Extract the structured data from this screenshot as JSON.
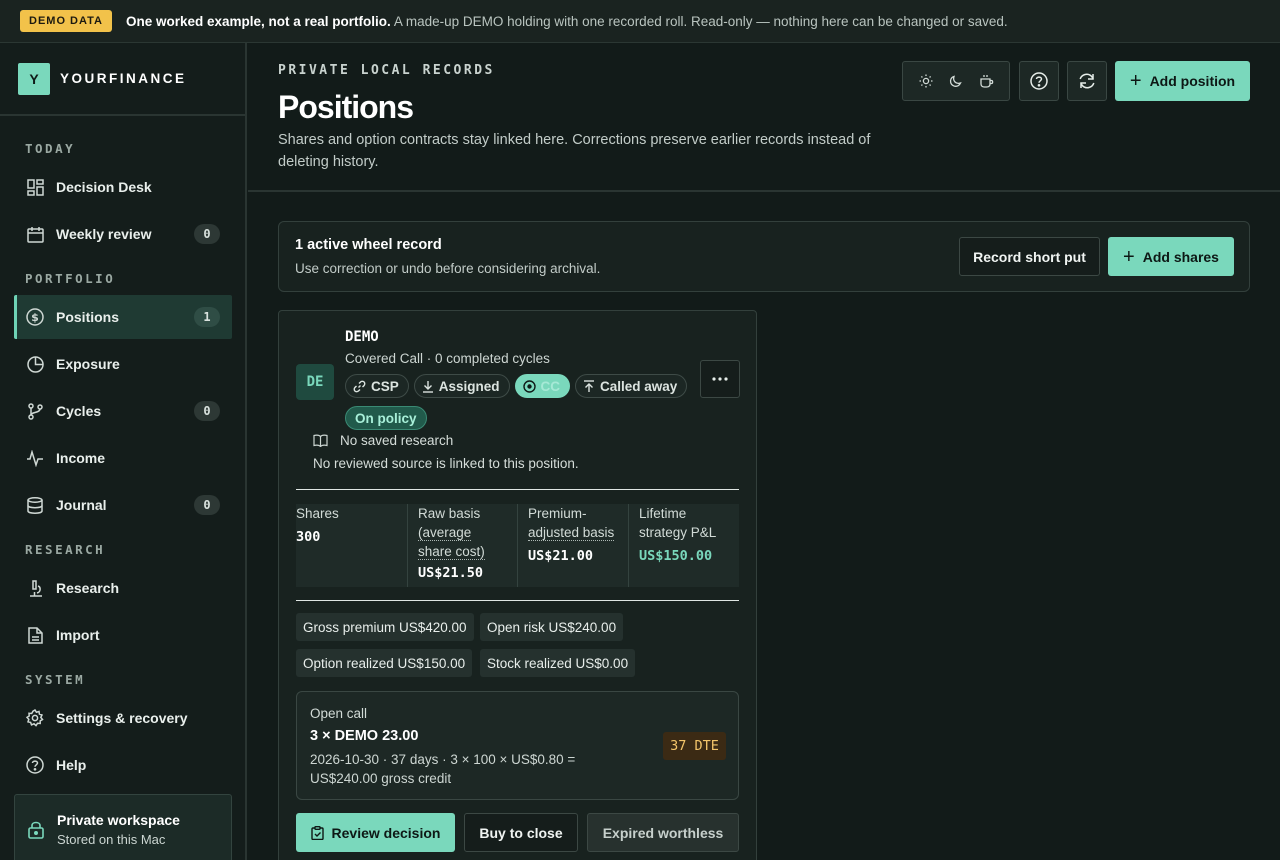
{
  "banner": {
    "badge": "DEMO DATA",
    "headline": "One worked example, not a real portfolio.",
    "text": "A made-up DEMO holding with one recorded roll. Read-only — nothing here can be changed or saved."
  },
  "brand": {
    "logo_letter": "Y",
    "name": "YOURFINANCE"
  },
  "sidebar": {
    "sections": [
      {
        "title": "TODAY",
        "items": [
          {
            "label": "Decision Desk",
            "icon": "grid-icon"
          },
          {
            "label": "Weekly review",
            "icon": "calendar-icon",
            "count": "0"
          }
        ]
      },
      {
        "title": "PORTFOLIO",
        "items": [
          {
            "label": "Positions",
            "icon": "dollar-circle-icon",
            "count": "1",
            "active": true
          },
          {
            "label": "Exposure",
            "icon": "pie-icon"
          },
          {
            "label": "Cycles",
            "icon": "branch-icon",
            "count": "0"
          },
          {
            "label": "Income",
            "icon": "pulse-icon"
          },
          {
            "label": "Journal",
            "icon": "database-icon",
            "count": "0"
          }
        ]
      },
      {
        "title": "RESEARCH",
        "items": [
          {
            "label": "Research",
            "icon": "microscope-icon"
          },
          {
            "label": "Import",
            "icon": "file-icon"
          }
        ]
      },
      {
        "title": "SYSTEM",
        "items": [
          {
            "label": "Settings & recovery",
            "icon": "gear-icon"
          },
          {
            "label": "Help",
            "icon": "help-icon"
          }
        ]
      }
    ],
    "workspace": {
      "title": "Private workspace",
      "subtitle": "Stored on this Mac"
    }
  },
  "header": {
    "eyebrow": "PRIVATE LOCAL RECORDS",
    "title": "Positions",
    "description": "Shares and option contracts stay linked here. Corrections preserve earlier records instead of deleting history.",
    "add_position_label": "Add position"
  },
  "summary": {
    "title": "1 active wheel record",
    "subtitle": "Use correction or undo before considering archival.",
    "record_short_put_label": "Record short put",
    "add_shares_label": "Add shares"
  },
  "position": {
    "avatar": "DE",
    "ticker": "DEMO",
    "strategy": "Covered Call · 0 completed cycles",
    "stages": [
      {
        "label": "CSP",
        "icon": "link-icon"
      },
      {
        "label": "Assigned",
        "icon": "download-icon"
      },
      {
        "label": "CC",
        "icon": "target-icon",
        "current": true
      },
      {
        "label": "Called away",
        "icon": "upload-icon"
      }
    ],
    "policy": "On policy",
    "research_title": "No saved research",
    "research_note": "No reviewed source is linked to this position.",
    "metrics": [
      {
        "label": "Shares",
        "value": "300"
      },
      {
        "label_top": "Raw basis",
        "label_ul": "(average share cost)",
        "value": "US$21.50"
      },
      {
        "label_top": "Premium-",
        "label_ul": "adjusted basis",
        "value": "US$21.00"
      },
      {
        "label": "Lifetime strategy P&L",
        "value": "US$150.00"
      }
    ],
    "pills": {
      "gross_premium": "Gross premium US$420.00",
      "open_risk": "Open risk US$240.00",
      "option_realized": "Option realized US$150.00",
      "stock_realized": "Stock realized US$0.00"
    },
    "open_call": {
      "label": "Open call",
      "title": "3 × DEMO 23.00",
      "detail": "2026-10-30 · 37 days · 3 × 100 × US$0.80 = US$240.00 gross credit",
      "dte": "37 DTE"
    },
    "actions": {
      "review": "Review decision",
      "buy_to_close": "Buy to close",
      "expired": "Expired worthless"
    }
  },
  "colors": {
    "accent": "#7ad8bc",
    "background": "#121b19",
    "warning": "#f3c56a"
  }
}
